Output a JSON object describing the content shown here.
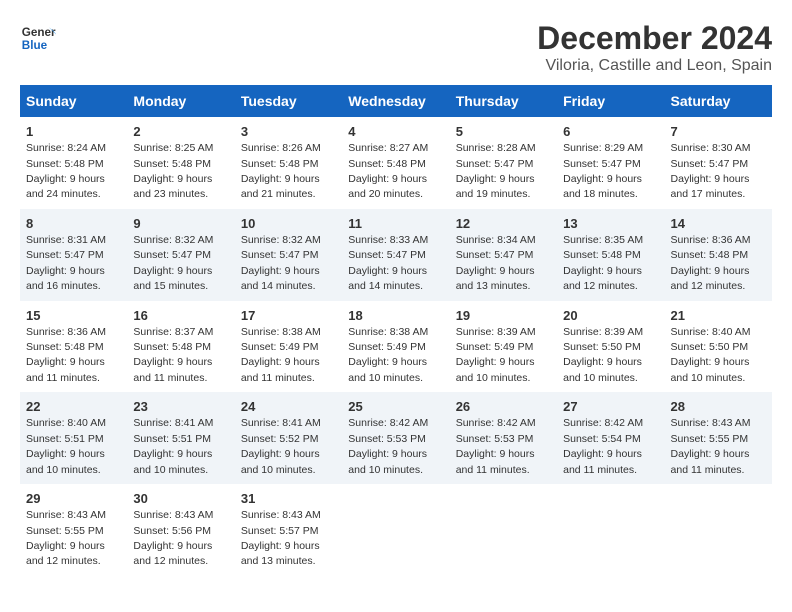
{
  "logo": {
    "line1": "General",
    "line2": "Blue"
  },
  "title": "December 2024",
  "subtitle": "Viloria, Castille and Leon, Spain",
  "days_of_week": [
    "Sunday",
    "Monday",
    "Tuesday",
    "Wednesday",
    "Thursday",
    "Friday",
    "Saturday"
  ],
  "weeks": [
    [
      {
        "day": "1",
        "sunrise": "Sunrise: 8:24 AM",
        "sunset": "Sunset: 5:48 PM",
        "daylight": "Daylight: 9 hours and 24 minutes."
      },
      {
        "day": "2",
        "sunrise": "Sunrise: 8:25 AM",
        "sunset": "Sunset: 5:48 PM",
        "daylight": "Daylight: 9 hours and 23 minutes."
      },
      {
        "day": "3",
        "sunrise": "Sunrise: 8:26 AM",
        "sunset": "Sunset: 5:48 PM",
        "daylight": "Daylight: 9 hours and 21 minutes."
      },
      {
        "day": "4",
        "sunrise": "Sunrise: 8:27 AM",
        "sunset": "Sunset: 5:48 PM",
        "daylight": "Daylight: 9 hours and 20 minutes."
      },
      {
        "day": "5",
        "sunrise": "Sunrise: 8:28 AM",
        "sunset": "Sunset: 5:47 PM",
        "daylight": "Daylight: 9 hours and 19 minutes."
      },
      {
        "day": "6",
        "sunrise": "Sunrise: 8:29 AM",
        "sunset": "Sunset: 5:47 PM",
        "daylight": "Daylight: 9 hours and 18 minutes."
      },
      {
        "day": "7",
        "sunrise": "Sunrise: 8:30 AM",
        "sunset": "Sunset: 5:47 PM",
        "daylight": "Daylight: 9 hours and 17 minutes."
      }
    ],
    [
      {
        "day": "8",
        "sunrise": "Sunrise: 8:31 AM",
        "sunset": "Sunset: 5:47 PM",
        "daylight": "Daylight: 9 hours and 16 minutes."
      },
      {
        "day": "9",
        "sunrise": "Sunrise: 8:32 AM",
        "sunset": "Sunset: 5:47 PM",
        "daylight": "Daylight: 9 hours and 15 minutes."
      },
      {
        "day": "10",
        "sunrise": "Sunrise: 8:32 AM",
        "sunset": "Sunset: 5:47 PM",
        "daylight": "Daylight: 9 hours and 14 minutes."
      },
      {
        "day": "11",
        "sunrise": "Sunrise: 8:33 AM",
        "sunset": "Sunset: 5:47 PM",
        "daylight": "Daylight: 9 hours and 14 minutes."
      },
      {
        "day": "12",
        "sunrise": "Sunrise: 8:34 AM",
        "sunset": "Sunset: 5:47 PM",
        "daylight": "Daylight: 9 hours and 13 minutes."
      },
      {
        "day": "13",
        "sunrise": "Sunrise: 8:35 AM",
        "sunset": "Sunset: 5:48 PM",
        "daylight": "Daylight: 9 hours and 12 minutes."
      },
      {
        "day": "14",
        "sunrise": "Sunrise: 8:36 AM",
        "sunset": "Sunset: 5:48 PM",
        "daylight": "Daylight: 9 hours and 12 minutes."
      }
    ],
    [
      {
        "day": "15",
        "sunrise": "Sunrise: 8:36 AM",
        "sunset": "Sunset: 5:48 PM",
        "daylight": "Daylight: 9 hours and 11 minutes."
      },
      {
        "day": "16",
        "sunrise": "Sunrise: 8:37 AM",
        "sunset": "Sunset: 5:48 PM",
        "daylight": "Daylight: 9 hours and 11 minutes."
      },
      {
        "day": "17",
        "sunrise": "Sunrise: 8:38 AM",
        "sunset": "Sunset: 5:49 PM",
        "daylight": "Daylight: 9 hours and 11 minutes."
      },
      {
        "day": "18",
        "sunrise": "Sunrise: 8:38 AM",
        "sunset": "Sunset: 5:49 PM",
        "daylight": "Daylight: 9 hours and 10 minutes."
      },
      {
        "day": "19",
        "sunrise": "Sunrise: 8:39 AM",
        "sunset": "Sunset: 5:49 PM",
        "daylight": "Daylight: 9 hours and 10 minutes."
      },
      {
        "day": "20",
        "sunrise": "Sunrise: 8:39 AM",
        "sunset": "Sunset: 5:50 PM",
        "daylight": "Daylight: 9 hours and 10 minutes."
      },
      {
        "day": "21",
        "sunrise": "Sunrise: 8:40 AM",
        "sunset": "Sunset: 5:50 PM",
        "daylight": "Daylight: 9 hours and 10 minutes."
      }
    ],
    [
      {
        "day": "22",
        "sunrise": "Sunrise: 8:40 AM",
        "sunset": "Sunset: 5:51 PM",
        "daylight": "Daylight: 9 hours and 10 minutes."
      },
      {
        "day": "23",
        "sunrise": "Sunrise: 8:41 AM",
        "sunset": "Sunset: 5:51 PM",
        "daylight": "Daylight: 9 hours and 10 minutes."
      },
      {
        "day": "24",
        "sunrise": "Sunrise: 8:41 AM",
        "sunset": "Sunset: 5:52 PM",
        "daylight": "Daylight: 9 hours and 10 minutes."
      },
      {
        "day": "25",
        "sunrise": "Sunrise: 8:42 AM",
        "sunset": "Sunset: 5:53 PM",
        "daylight": "Daylight: 9 hours and 10 minutes."
      },
      {
        "day": "26",
        "sunrise": "Sunrise: 8:42 AM",
        "sunset": "Sunset: 5:53 PM",
        "daylight": "Daylight: 9 hours and 11 minutes."
      },
      {
        "day": "27",
        "sunrise": "Sunrise: 8:42 AM",
        "sunset": "Sunset: 5:54 PM",
        "daylight": "Daylight: 9 hours and 11 minutes."
      },
      {
        "day": "28",
        "sunrise": "Sunrise: 8:43 AM",
        "sunset": "Sunset: 5:55 PM",
        "daylight": "Daylight: 9 hours and 11 minutes."
      }
    ],
    [
      {
        "day": "29",
        "sunrise": "Sunrise: 8:43 AM",
        "sunset": "Sunset: 5:55 PM",
        "daylight": "Daylight: 9 hours and 12 minutes."
      },
      {
        "day": "30",
        "sunrise": "Sunrise: 8:43 AM",
        "sunset": "Sunset: 5:56 PM",
        "daylight": "Daylight: 9 hours and 12 minutes."
      },
      {
        "day": "31",
        "sunrise": "Sunrise: 8:43 AM",
        "sunset": "Sunset: 5:57 PM",
        "daylight": "Daylight: 9 hours and 13 minutes."
      },
      {
        "day": "",
        "sunrise": "",
        "sunset": "",
        "daylight": ""
      },
      {
        "day": "",
        "sunrise": "",
        "sunset": "",
        "daylight": ""
      },
      {
        "day": "",
        "sunrise": "",
        "sunset": "",
        "daylight": ""
      },
      {
        "day": "",
        "sunrise": "",
        "sunset": "",
        "daylight": ""
      }
    ]
  ]
}
